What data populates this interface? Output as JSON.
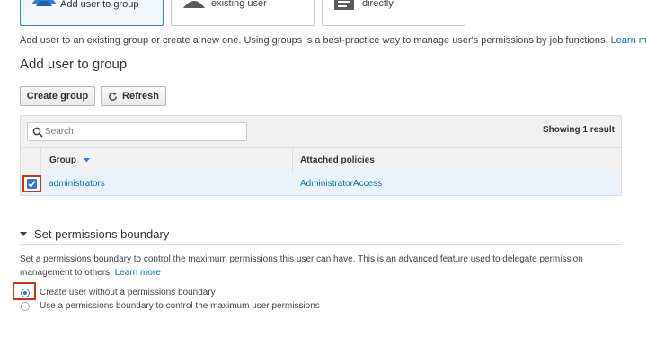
{
  "options": [
    {
      "label": "Add user to group",
      "icon": "users-group-icon",
      "selected": true
    },
    {
      "label": "Copy permissions from\nexisting user",
      "icon": "user-icon",
      "selected": false
    },
    {
      "label": "Attach existing policies\ndirectly",
      "icon": "document-icon",
      "selected": false
    }
  ],
  "intro": {
    "text": "Add user to an existing group or create a new one. Using groups is a best-practice way to manage user's permissions by job functions. ",
    "link": "Learn more"
  },
  "section_title": "Add user to group",
  "buttons": {
    "create_group": "Create group",
    "refresh": "Refresh"
  },
  "search": {
    "placeholder": "Search"
  },
  "result_count": "Showing 1 result",
  "table": {
    "columns": [
      "Group",
      "Attached policies"
    ],
    "rows": [
      {
        "group": "administrators",
        "policy": "AdministratorAccess",
        "checked": true
      }
    ]
  },
  "boundary": {
    "title": "Set permissions boundary",
    "description": "Set a permissions boundary to control the maximum permissions this user can have. This is an advanced feature used to delegate permission management to others. ",
    "link": "Learn more",
    "options": [
      {
        "label": "Create user without a permissions boundary",
        "checked": true
      },
      {
        "label": "Use a permissions boundary to control the maximum user permissions",
        "checked": false
      }
    ]
  },
  "colors": {
    "accent": "#2f7dd6",
    "link": "#0073bb",
    "highlight": "#d13212"
  }
}
